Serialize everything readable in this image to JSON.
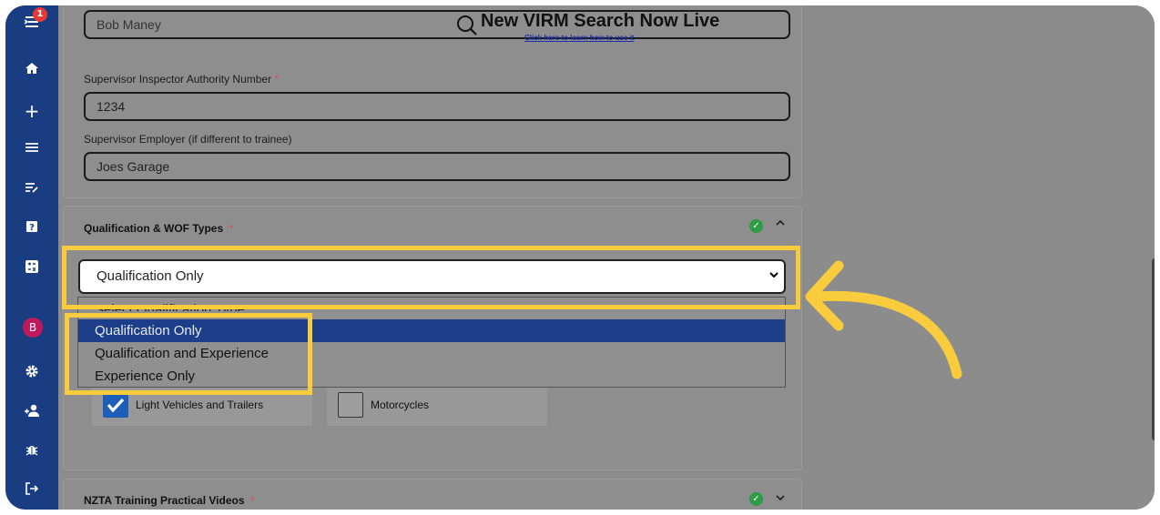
{
  "sidebar": {
    "notification_count": "1",
    "avatar_initial": "B",
    "icons": [
      "menu-expand-icon",
      "home-icon",
      "plus-icon",
      "list-icon",
      "edit-list-icon",
      "help-icon",
      "calculator-icon",
      "settings-icon",
      "add-user-icon",
      "bug-icon",
      "logout-icon"
    ]
  },
  "banner": {
    "title": "New VIRM Search Now Live",
    "link": "Click here to learn how to use it"
  },
  "supervisor": {
    "name_value": "Bob Maney",
    "authority_label": "Supervisor Inspector Authority Number",
    "authority_value": "1234",
    "employer_label": "Supervisor Employer (if different to trainee)",
    "employer_value": "Joes Garage"
  },
  "qualification": {
    "title": "Qualification & WOF Types",
    "selected": "Qualification Only",
    "options": [
      "Select Qualification Type",
      "Qualification Only",
      "Qualification and Experience",
      "Experience Only"
    ]
  },
  "wof_types": [
    {
      "label": "Light Vehicles and Trailers",
      "checked": true
    },
    {
      "label": "Motorcycles",
      "checked": false
    }
  ],
  "videos_section": {
    "title": "NZTA Training Practical Videos"
  },
  "colors": {
    "highlight": "#f8cc3d",
    "sidebar": "#1a3c80",
    "selected_option": "#1d3f8a",
    "success": "#2e9b45"
  }
}
